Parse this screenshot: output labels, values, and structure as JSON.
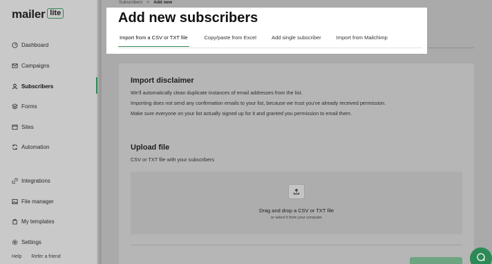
{
  "logo": {
    "text": "mailer",
    "badge": "lite"
  },
  "sidebar": {
    "items": [
      {
        "label": "Dashboard",
        "icon": "dashboard-icon"
      },
      {
        "label": "Campaigns",
        "icon": "mail-icon"
      },
      {
        "label": "Subscribers",
        "icon": "user-icon",
        "active": true
      },
      {
        "label": "Forms",
        "icon": "forms-icon"
      },
      {
        "label": "Sites",
        "icon": "sites-icon"
      },
      {
        "label": "Automation",
        "icon": "automation-icon"
      },
      {
        "label": "Integrations",
        "icon": "link-icon"
      },
      {
        "label": "File manager",
        "icon": "image-icon"
      },
      {
        "label": "My templates",
        "icon": "template-icon"
      },
      {
        "label": "Settings",
        "icon": "gear-icon"
      }
    ],
    "footer": {
      "help": "Help",
      "refer": "Refer a friend"
    }
  },
  "breadcrumb": {
    "parent": "Subscribers",
    "separator": ">",
    "current": "Add new"
  },
  "header": {
    "title": "Add new subscribers",
    "tabs": [
      {
        "label": "Import from a CSV or TXT file",
        "active": true
      },
      {
        "label": "Copy/paste from Excel"
      },
      {
        "label": "Add single subscriber"
      },
      {
        "label": "Import from Mailchimp"
      }
    ]
  },
  "disclaimer": {
    "title": "Import disclaimer",
    "lines": [
      "We'll automatically clean duplicate instances of email addresses from the list.",
      "Importing does not send any confirmation emails to your list, because we trust you've already received permission.",
      "Make sure everyone on your list actually signed up for it and granted you permission to email them."
    ]
  },
  "upload": {
    "title": "Upload file",
    "subtitle": "CSV or TXT file with your subscribers",
    "drop_title": "Drag and drop a CSV or TXT file",
    "drop_sub": "or select it from your computer"
  },
  "colors": {
    "accent": "#2f8a55",
    "chat": "#2d8a57"
  }
}
